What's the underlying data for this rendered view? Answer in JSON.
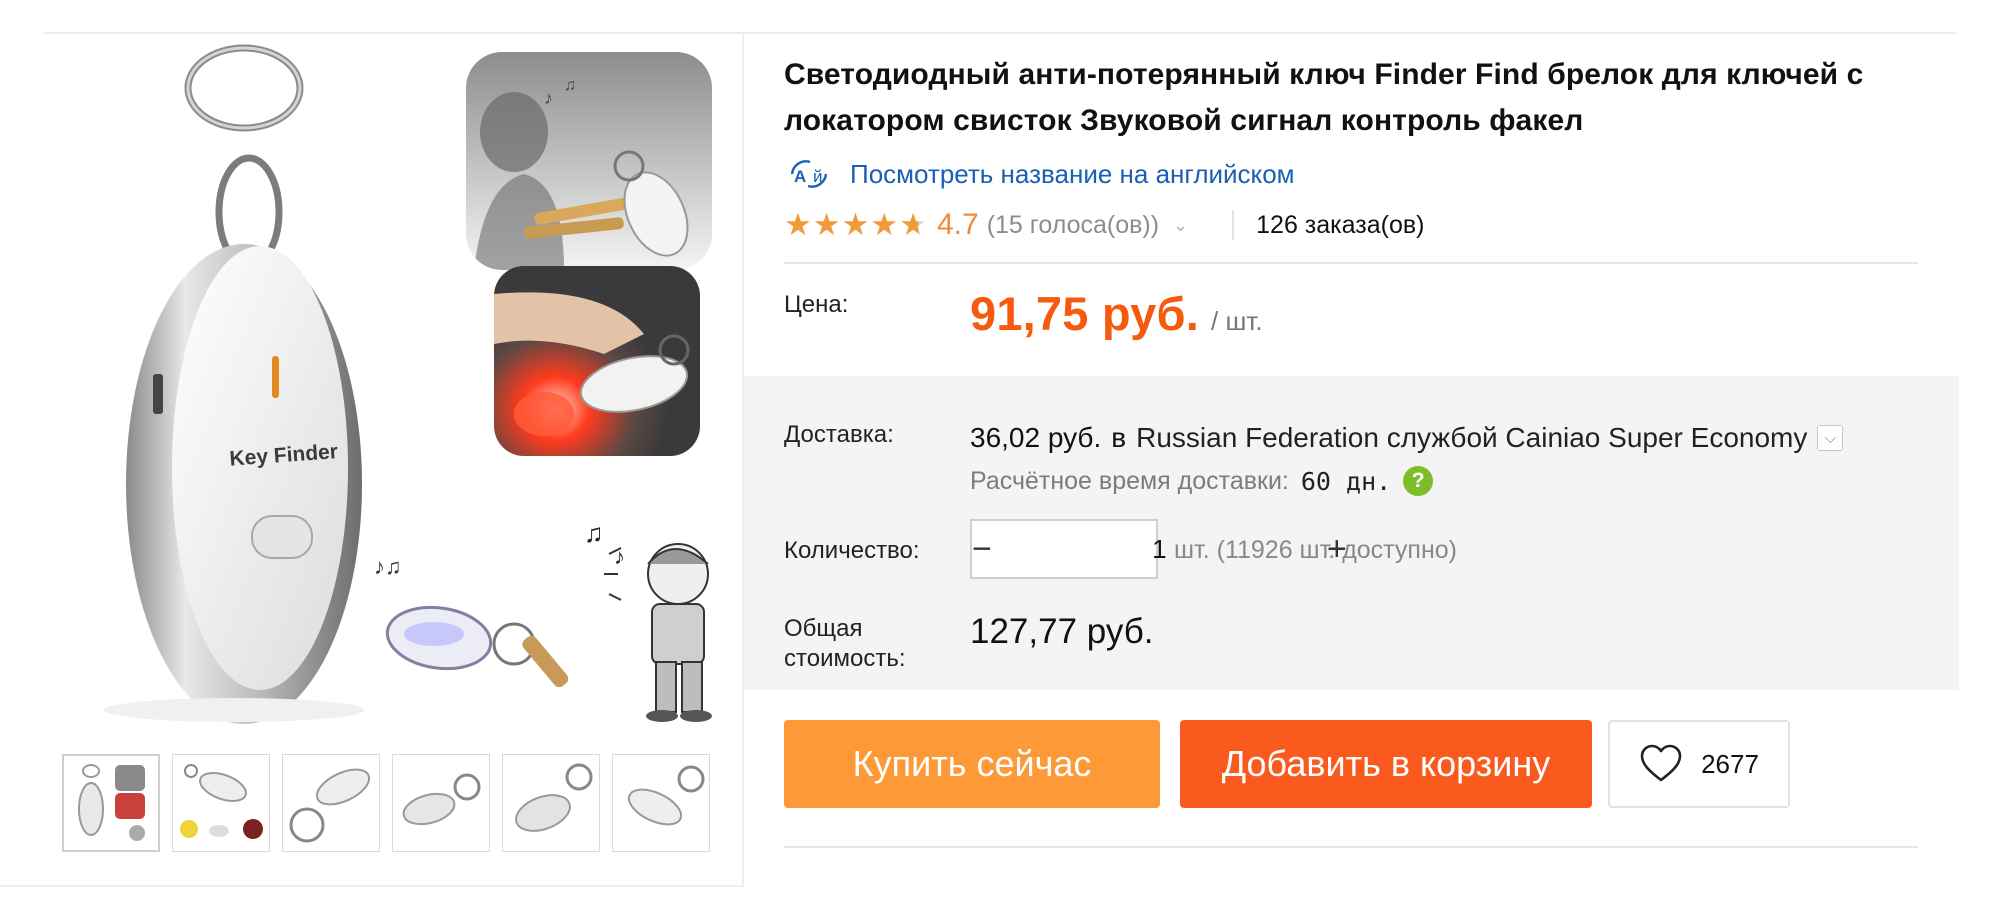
{
  "product": {
    "title": "Светодиодный анти-потерянный ключ Finder Find брелок для ключей с локатором свисток Звуковой сигнал контроль факел",
    "image_brand_text": "Key Finder"
  },
  "translate": {
    "icon": "translate-icon",
    "label": "Посмотреть название на английском"
  },
  "rating": {
    "stars": 4.7,
    "value": "4.7",
    "votes": "(15 голоса(ов))",
    "orders": "126 заказа(ов)"
  },
  "price": {
    "label": "Цена:",
    "value": "91,75 руб.",
    "unit": "/ шт."
  },
  "shipping": {
    "label": "Доставка:",
    "cost": "36,02 руб.",
    "preposition": "в",
    "method": "Russian Federation службой Cainiao Super Economy",
    "eta_label": "Расчётное время доставки:",
    "eta_value": "60 дн."
  },
  "quantity": {
    "label": "Количество:",
    "value": "1",
    "minus": "−",
    "plus": "+",
    "available": "шт. (11926 шт. доступно)"
  },
  "total": {
    "label": "Общая стоимость:",
    "value": "127,77 руб."
  },
  "actions": {
    "buy_now": "Купить сейчас",
    "add_to_cart": "Добавить в корзину",
    "wishlist_count": "2677"
  },
  "gallery": {
    "thumbnail_count": 6,
    "active_index": 0
  },
  "colors": {
    "price": "#f55a0e",
    "buy_button": "#fd9a37",
    "cart_button": "#fb5a1e",
    "star": "#f09a3a",
    "link": "#1a5fb4",
    "help": "#7dbd2a"
  }
}
